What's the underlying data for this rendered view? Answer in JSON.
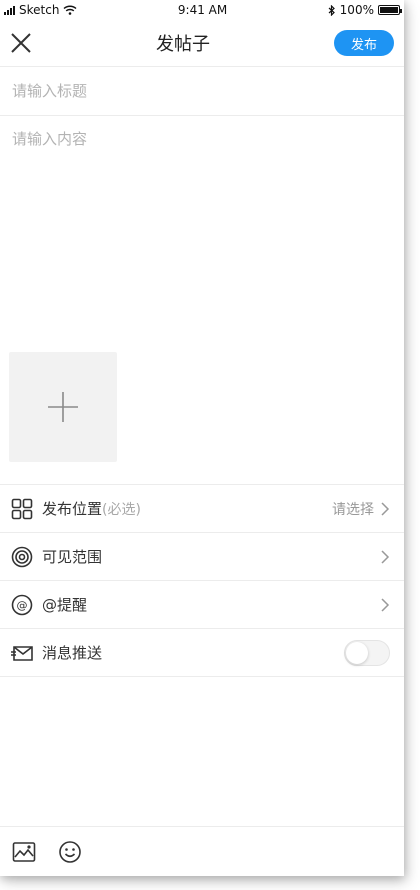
{
  "status_bar": {
    "carrier": "Sketch",
    "time": "9:41 AM",
    "battery": "100%",
    "battery_level": 1.0
  },
  "navbar": {
    "title": "发帖子",
    "publish_label": "发布",
    "close_icon": "close-icon"
  },
  "title_field": {
    "placeholder": "请输入标题",
    "value": ""
  },
  "content_field": {
    "placeholder": "请输入内容",
    "value": ""
  },
  "add_image": {
    "icon": "plus-icon"
  },
  "options": {
    "location": {
      "label": "发布位置",
      "hint": "(必选)",
      "value": "请选择",
      "icon": "grid-icon"
    },
    "visibility": {
      "label": "可见范围",
      "icon": "target-icon"
    },
    "mention": {
      "label": "@提醒",
      "icon": "at-icon"
    },
    "push": {
      "label": "消息推送",
      "icon": "envelope-icon",
      "enabled": false
    }
  },
  "toolbar": {
    "image_icon": "image-icon",
    "emoji_icon": "emoji-icon"
  }
}
